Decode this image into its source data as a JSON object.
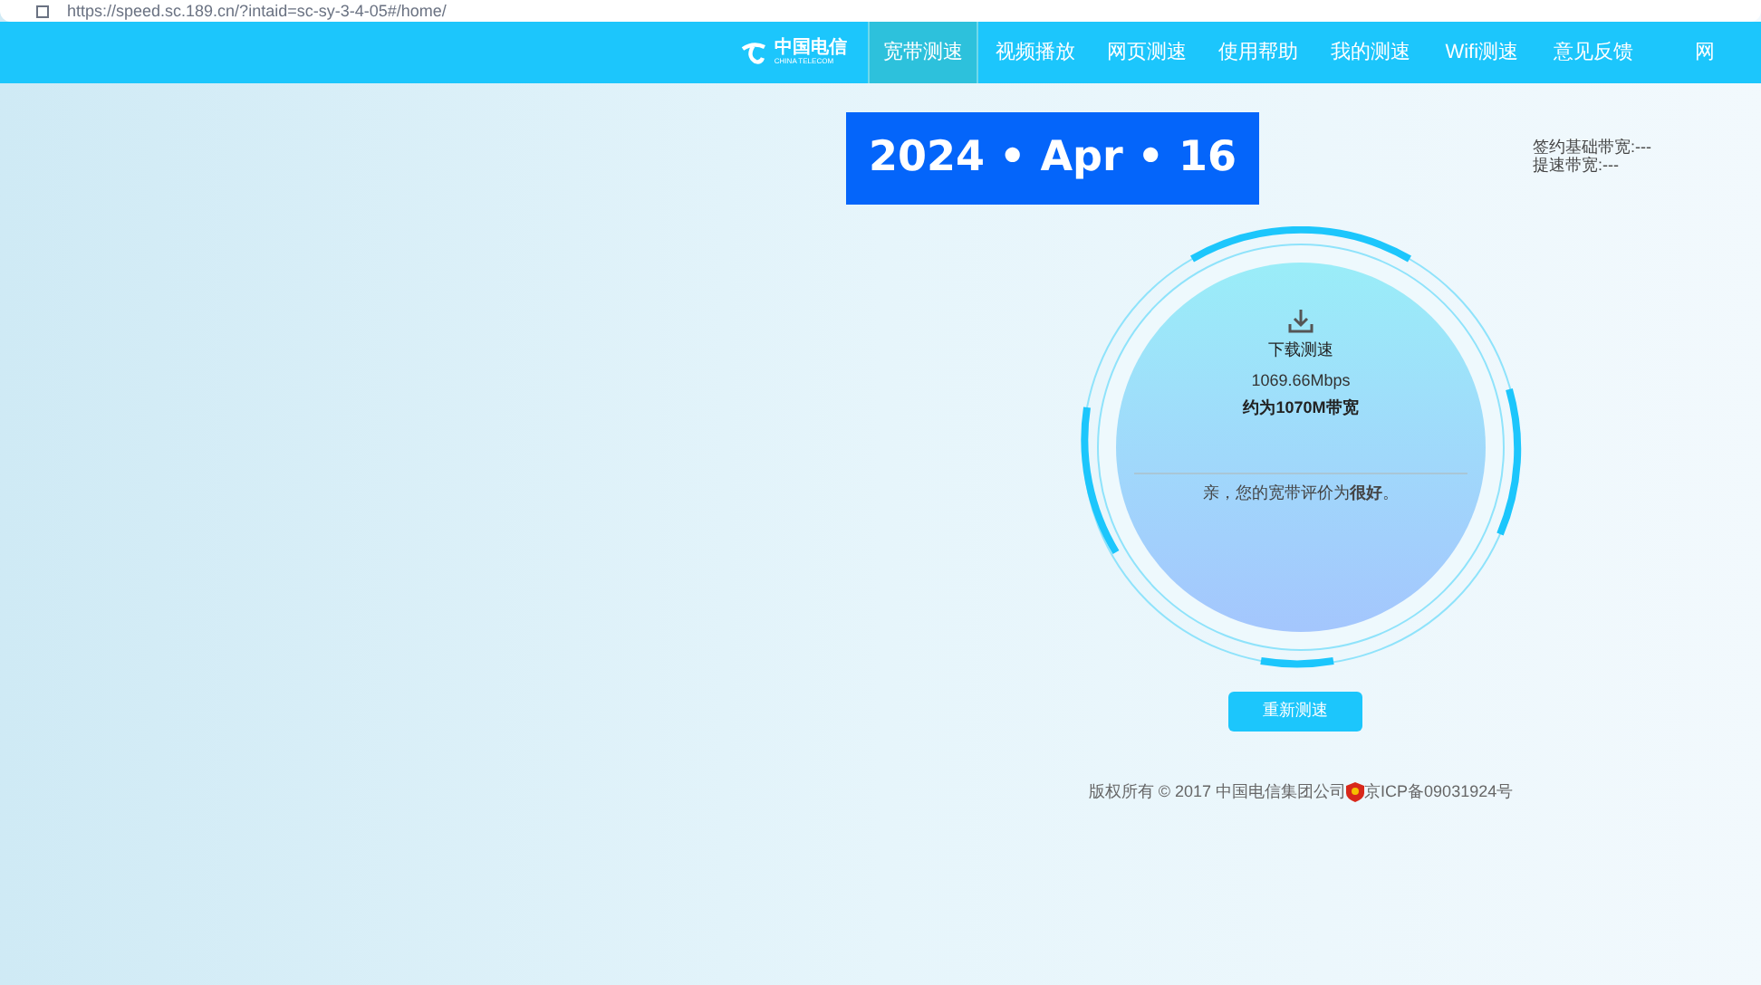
{
  "browser": {
    "url": "https://speed.sc.189.cn/?intaid=sc-sy-3-4-05#/home/"
  },
  "logo": {
    "name": "中国电信",
    "subtitle": "CHINA TELECOM"
  },
  "nav": [
    {
      "label": "宽带测速",
      "selected": true
    },
    {
      "label": "视频播放",
      "selected": false
    },
    {
      "label": "网页测速",
      "selected": false
    },
    {
      "label": "使用帮助",
      "selected": false
    },
    {
      "label": "我的测速",
      "selected": false
    },
    {
      "label": "Wifi测速",
      "selected": false
    },
    {
      "label": "意见反馈",
      "selected": false
    },
    {
      "label": "网",
      "selected": false
    }
  ],
  "date_stamp": "2024 • Apr • 16",
  "bandwidth_info": [
    "签约基础带宽:---",
    "提速带宽:---"
  ],
  "gauge": {
    "title": "下载测速",
    "speed": "1069.66Mbps",
    "estimate": "约为1070M带宽",
    "rating": "亲，您的宽带评价为**很好**。"
  },
  "retest_button": "重新测速",
  "footer": {
    "copyright": "版权所有 © 2017 中国电信集团公司",
    "icp": "京ICP备09031924号"
  }
}
